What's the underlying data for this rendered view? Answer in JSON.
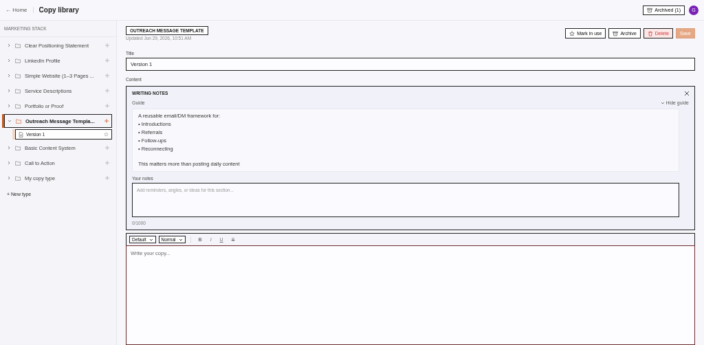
{
  "header": {
    "back_link": "← Home",
    "title": "Copy library",
    "archived_button": "Archived (1)",
    "avatar": "G"
  },
  "sidebar": {
    "heading": "MARKETING STACK",
    "types": [
      {
        "label": "Clear Positioning Statement",
        "expanded": false,
        "selected": false
      },
      {
        "label": "LinkedIn Profile",
        "expanded": false,
        "selected": false
      },
      {
        "label": "Simple Website (1–3 Pages ...",
        "expanded": false,
        "selected": false
      },
      {
        "label": "Service Descriptions",
        "expanded": false,
        "selected": false
      },
      {
        "label": "Portfolio or Proof",
        "expanded": false,
        "selected": false
      },
      {
        "label": "Outreach Message Templa...",
        "expanded": true,
        "selected": true,
        "children": [
          {
            "label": "Version 1",
            "selected": true
          }
        ]
      },
      {
        "label": "Basic Content System",
        "expanded": false,
        "selected": false
      },
      {
        "label": "Call to Action",
        "expanded": false,
        "selected": false
      },
      {
        "label": "My copy type",
        "expanded": false,
        "selected": false
      }
    ],
    "new_type": "+ New type"
  },
  "main": {
    "type_badge": "OUTREACH MESSAGE TEMPLATE",
    "updated": "Updated Jun 29, 2026, 10:51 AM",
    "actions": [
      {
        "label": "Mark in use",
        "kind": "star"
      },
      {
        "label": "Archive",
        "kind": "archive"
      },
      {
        "label": "Delete",
        "kind": "delete"
      },
      {
        "label": "Save",
        "kind": "save",
        "disabled": true
      }
    ],
    "title_label": "Title",
    "title_value": "Version 1",
    "content_label": "Content",
    "notes": {
      "heading": "WRITING NOTES",
      "guide_label": "Guide",
      "hide_guide": "Hide guide",
      "guide_intro": "A reusable email/DM framework for:",
      "guide_bullets": [
        "• Introductions",
        "• Referrals",
        "• Follow-ups",
        "• Reconnecting"
      ],
      "guide_closing": "This matters more than posting daily content",
      "your_notes_label": "Your notes",
      "notes_placeholder": "Add reminders, angles, or ideas for this section...",
      "counter": "0/1000"
    },
    "toolbar": {
      "font": "Default",
      "size": "Normal",
      "formats": [
        "B",
        "I",
        "U",
        "S"
      ]
    },
    "editor_placeholder": "Write your copy..."
  }
}
